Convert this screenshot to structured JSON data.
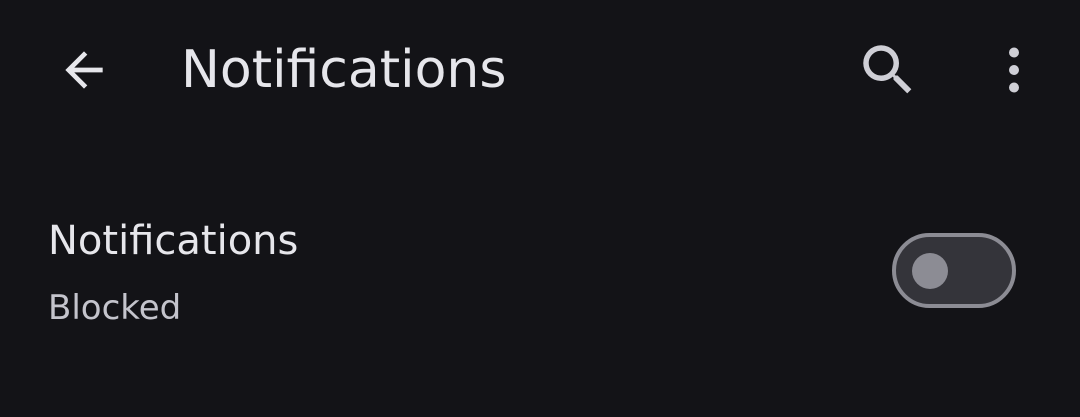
{
  "header": {
    "title": "Notifications"
  },
  "setting": {
    "title": "Notifications",
    "summary": "Blocked",
    "enabled": false
  },
  "icons": {
    "back": "arrow-left-icon",
    "search": "search-icon",
    "more": "more-vert-icon"
  },
  "colors": {
    "background": "#131317",
    "text_primary": "#e6e6eb",
    "text_secondary": "#c4c4cc",
    "switch_off_track": "#34343a",
    "switch_off_outline": "#8c8c94"
  }
}
